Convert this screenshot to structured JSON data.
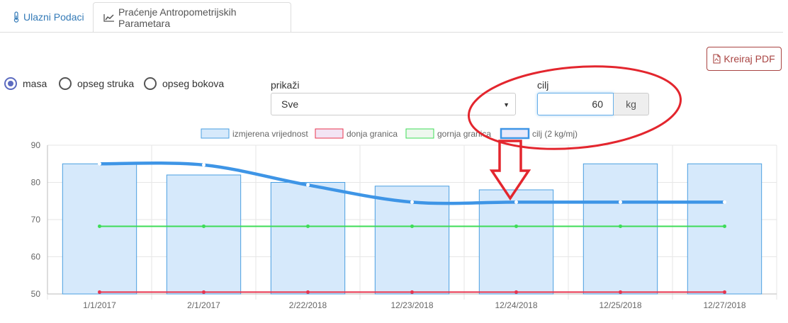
{
  "tabs": [
    {
      "label": "Ulazni Podaci",
      "icon": "thermometer-icon"
    },
    {
      "label": "Praćenje Antropometrijskih Parametara",
      "icon": "line-chart-icon",
      "active": true
    }
  ],
  "pdf_button": {
    "label": "Kreiraj PDF",
    "icon": "file-pdf-icon",
    "color": "#a94442"
  },
  "radios": [
    {
      "label": "masa",
      "checked": true
    },
    {
      "label": "opseg struka",
      "checked": false
    },
    {
      "label": "opseg bokova",
      "checked": false
    }
  ],
  "prikazi": {
    "label": "prikaži",
    "selected": "Sve"
  },
  "cilj": {
    "label": "cilj",
    "value": "60",
    "unit": "kg"
  },
  "colors": {
    "bar_fill": "#d6e9fb",
    "bar_stroke": "#4a9fe0",
    "goal_line": "#3e95e6",
    "lower": "#e8344e",
    "upper": "#3ddc57",
    "annotation": "#e3262e"
  },
  "chart_data": {
    "type": "bar",
    "categories": [
      "1/1/2017",
      "2/1/2017",
      "2/22/2018",
      "12/23/2018",
      "12/24/2018",
      "12/25/2018",
      "12/27/2018"
    ],
    "ylim": [
      50,
      90
    ],
    "yticks": [
      "50",
      "60",
      "70",
      "80",
      "90"
    ],
    "grid": true,
    "legend_position": "top",
    "series": [
      {
        "name": "izmjerena vrijednost",
        "type": "bar",
        "values": [
          85,
          82,
          80,
          79,
          78,
          85,
          85
        ]
      },
      {
        "name": "donja granica",
        "type": "line",
        "values": [
          50.5,
          50.5,
          50.5,
          50.5,
          50.5,
          50.5,
          50.5
        ]
      },
      {
        "name": "gornja granica",
        "type": "line",
        "values": [
          68.2,
          68.2,
          68.2,
          68.2,
          68.2,
          68.2,
          68.2
        ]
      },
      {
        "name": "cilj (2 kg/mj)",
        "type": "line",
        "values": [
          85,
          84.7,
          79.3,
          74.7,
          74.7,
          74.7,
          74.7
        ]
      }
    ]
  }
}
